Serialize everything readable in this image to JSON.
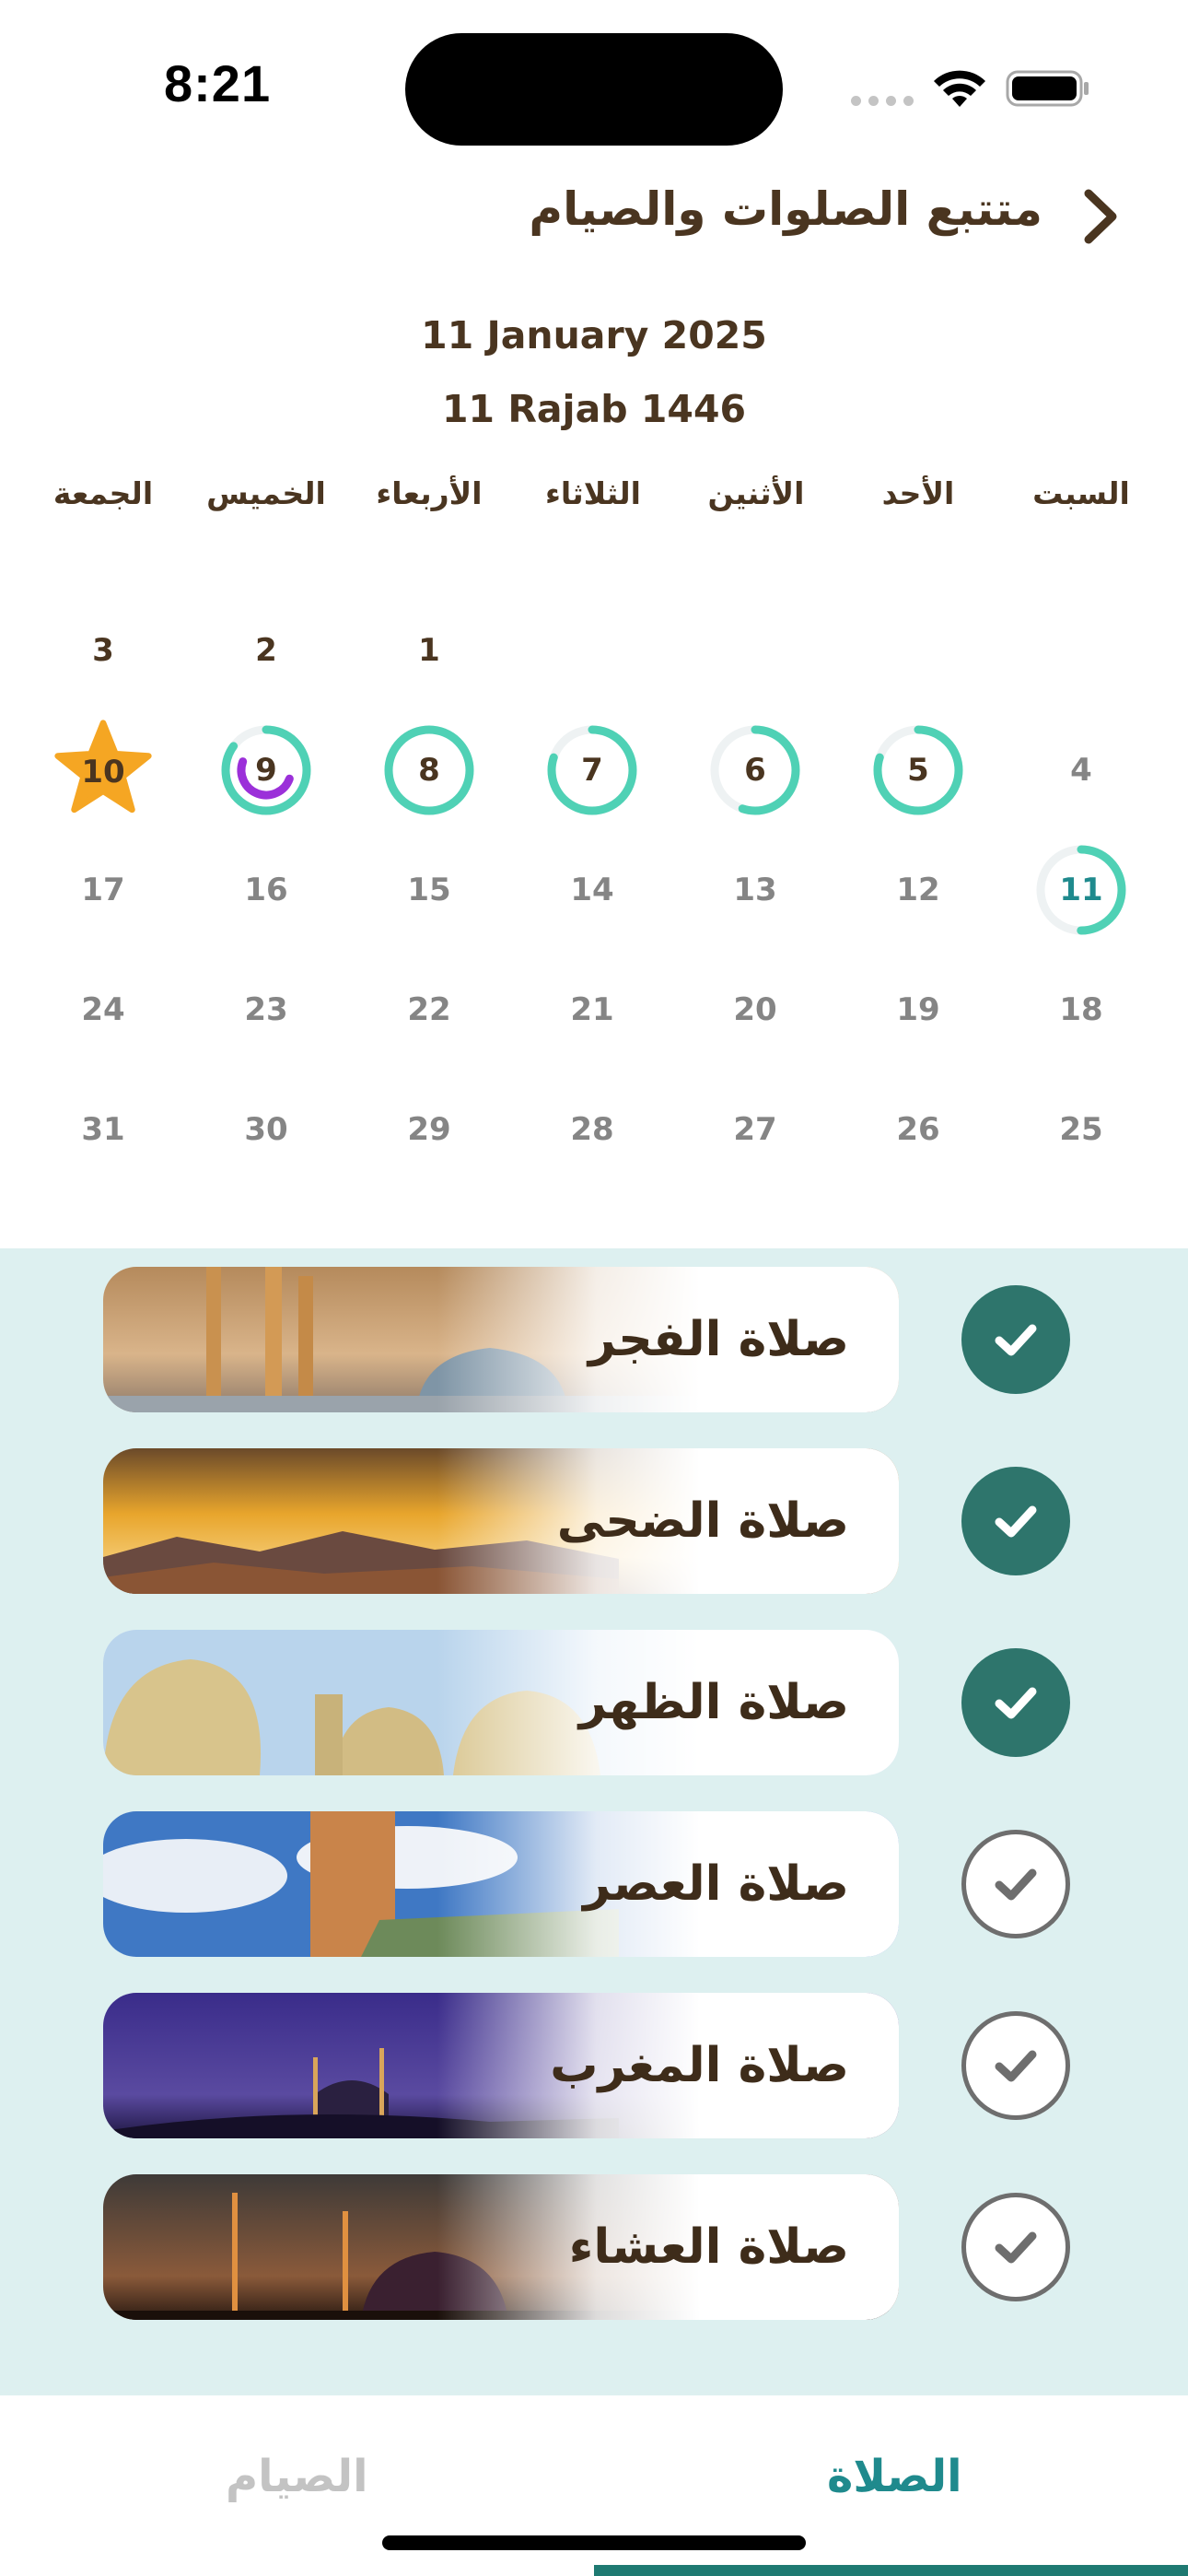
{
  "status_bar": {
    "time": "8:21"
  },
  "header": {
    "title": "متتبع الصلوات والصيام",
    "back_icon": "chevron-right-icon"
  },
  "dates": {
    "gregorian": "11 January 2025",
    "hijri": "11 Rajab 1446"
  },
  "weekdays": [
    "السبت",
    "الأحد",
    "الأثنين",
    "الثلاثاء",
    "الأربعاء",
    "الخميس",
    "الجمعة"
  ],
  "calendar": {
    "days": [
      {
        "day": "1",
        "status": "plain",
        "progress": 0
      },
      {
        "day": "2",
        "status": "plain",
        "progress": 0
      },
      {
        "day": "3",
        "status": "plain",
        "progress": 0
      },
      {
        "day": "4",
        "status": "plain",
        "progress": 0
      },
      {
        "day": "5",
        "status": "ring",
        "progress": 0.8
      },
      {
        "day": "6",
        "status": "ring",
        "progress": 0.55
      },
      {
        "day": "7",
        "status": "ring",
        "progress": 0.8
      },
      {
        "day": "8",
        "status": "ring",
        "progress": 1.0
      },
      {
        "day": "9",
        "status": "ring-fasting",
        "progress": 0.85,
        "fasting": 0.5
      },
      {
        "day": "10",
        "status": "star",
        "progress": 1.0
      },
      {
        "day": "11",
        "status": "today",
        "progress": 0.5
      },
      {
        "day": "12",
        "status": "plain",
        "progress": 0
      },
      {
        "day": "13",
        "status": "plain",
        "progress": 0
      },
      {
        "day": "14",
        "status": "plain",
        "progress": 0
      },
      {
        "day": "15",
        "status": "plain",
        "progress": 0
      },
      {
        "day": "16",
        "status": "plain",
        "progress": 0
      },
      {
        "day": "17",
        "status": "plain",
        "progress": 0
      },
      {
        "day": "18",
        "status": "plain",
        "progress": 0
      },
      {
        "day": "19",
        "status": "plain",
        "progress": 0
      },
      {
        "day": "20",
        "status": "plain",
        "progress": 0
      },
      {
        "day": "21",
        "status": "plain",
        "progress": 0
      },
      {
        "day": "22",
        "status": "plain",
        "progress": 0
      },
      {
        "day": "23",
        "status": "plain",
        "progress": 0
      },
      {
        "day": "24",
        "status": "plain",
        "progress": 0
      },
      {
        "day": "25",
        "status": "plain",
        "progress": 0
      },
      {
        "day": "26",
        "status": "plain",
        "progress": 0
      },
      {
        "day": "27",
        "status": "plain",
        "progress": 0
      },
      {
        "day": "28",
        "status": "plain",
        "progress": 0
      },
      {
        "day": "29",
        "status": "plain",
        "progress": 0
      },
      {
        "day": "30",
        "status": "plain",
        "progress": 0
      },
      {
        "day": "31",
        "status": "plain",
        "progress": 0
      }
    ],
    "first_weekday_index": 4
  },
  "prayers": [
    {
      "name": "صلاة الفجر",
      "done": true,
      "scene": "fajr"
    },
    {
      "name": "صلاة الضحى",
      "done": true,
      "scene": "duha"
    },
    {
      "name": "صلاة الظهر",
      "done": true,
      "scene": "dhuhr"
    },
    {
      "name": "صلاة العصر",
      "done": false,
      "scene": "asr"
    },
    {
      "name": "صلاة المغرب",
      "done": false,
      "scene": "maghrib"
    },
    {
      "name": "صلاة العشاء",
      "done": false,
      "scene": "isha"
    }
  ],
  "tabs": {
    "prayer": "الصلاة",
    "fasting": "الصيام",
    "active": "prayer"
  },
  "colors": {
    "accent": "#1f8a8d",
    "ring": "#4fd1b5",
    "fasting_ring": "#9b30d9",
    "star": "#f5a623",
    "check_on": "#2e756c",
    "panel_bg": "#ddf0f0",
    "text_dark": "#4a3520"
  }
}
